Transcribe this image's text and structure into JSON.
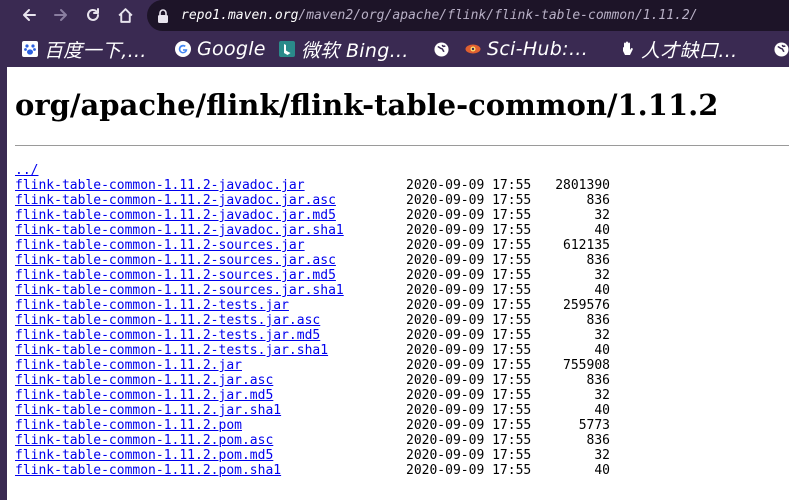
{
  "browser": {
    "url_host": "repo1.maven.org",
    "url_path": "/maven2/org/apache/flink/flink-table-common/1.11.2/",
    "bookmarks": [
      {
        "label": "百度一下,…",
        "icon": "baidu-paw-icon",
        "color": "#2b5fe0"
      },
      {
        "label": "Google",
        "icon": "google-g-icon"
      },
      {
        "label": "微软 Bing…",
        "icon": "bing-icon",
        "color": "#2a8a8a"
      },
      {
        "label": "",
        "icon": "globe-icon"
      },
      {
        "label": "Sci-Hub:…",
        "icon": "scihub-eye-icon",
        "color": "#e06030"
      },
      {
        "label": "人才缺口…",
        "icon": "hand-icon"
      },
      {
        "label": "",
        "icon": "globe-icon"
      }
    ]
  },
  "page": {
    "title": "org/apache/flink/flink-table-common/1.11.2",
    "parent_link": "../",
    "files": [
      {
        "name": "flink-table-common-1.11.2-javadoc.jar",
        "date": "2020-09-09 17:55",
        "size": "2801390"
      },
      {
        "name": "flink-table-common-1.11.2-javadoc.jar.asc",
        "date": "2020-09-09 17:55",
        "size": "836"
      },
      {
        "name": "flink-table-common-1.11.2-javadoc.jar.md5",
        "date": "2020-09-09 17:55",
        "size": "32"
      },
      {
        "name": "flink-table-common-1.11.2-javadoc.jar.sha1",
        "date": "2020-09-09 17:55",
        "size": "40"
      },
      {
        "name": "flink-table-common-1.11.2-sources.jar",
        "date": "2020-09-09 17:55",
        "size": "612135"
      },
      {
        "name": "flink-table-common-1.11.2-sources.jar.asc",
        "date": "2020-09-09 17:55",
        "size": "836"
      },
      {
        "name": "flink-table-common-1.11.2-sources.jar.md5",
        "date": "2020-09-09 17:55",
        "size": "32"
      },
      {
        "name": "flink-table-common-1.11.2-sources.jar.sha1",
        "date": "2020-09-09 17:55",
        "size": "40"
      },
      {
        "name": "flink-table-common-1.11.2-tests.jar",
        "date": "2020-09-09 17:55",
        "size": "259576"
      },
      {
        "name": "flink-table-common-1.11.2-tests.jar.asc",
        "date": "2020-09-09 17:55",
        "size": "836"
      },
      {
        "name": "flink-table-common-1.11.2-tests.jar.md5",
        "date": "2020-09-09 17:55",
        "size": "32"
      },
      {
        "name": "flink-table-common-1.11.2-tests.jar.sha1",
        "date": "2020-09-09 17:55",
        "size": "40"
      },
      {
        "name": "flink-table-common-1.11.2.jar",
        "date": "2020-09-09 17:55",
        "size": "755908"
      },
      {
        "name": "flink-table-common-1.11.2.jar.asc",
        "date": "2020-09-09 17:55",
        "size": "836"
      },
      {
        "name": "flink-table-common-1.11.2.jar.md5",
        "date": "2020-09-09 17:55",
        "size": "32"
      },
      {
        "name": "flink-table-common-1.11.2.jar.sha1",
        "date": "2020-09-09 17:55",
        "size": "40"
      },
      {
        "name": "flink-table-common-1.11.2.pom",
        "date": "2020-09-09 17:55",
        "size": "5773"
      },
      {
        "name": "flink-table-common-1.11.2.pom.asc",
        "date": "2020-09-09 17:55",
        "size": "836"
      },
      {
        "name": "flink-table-common-1.11.2.pom.md5",
        "date": "2020-09-09 17:55",
        "size": "32"
      },
      {
        "name": "flink-table-common-1.11.2.pom.sha1",
        "date": "2020-09-09 17:55",
        "size": "40"
      }
    ]
  }
}
